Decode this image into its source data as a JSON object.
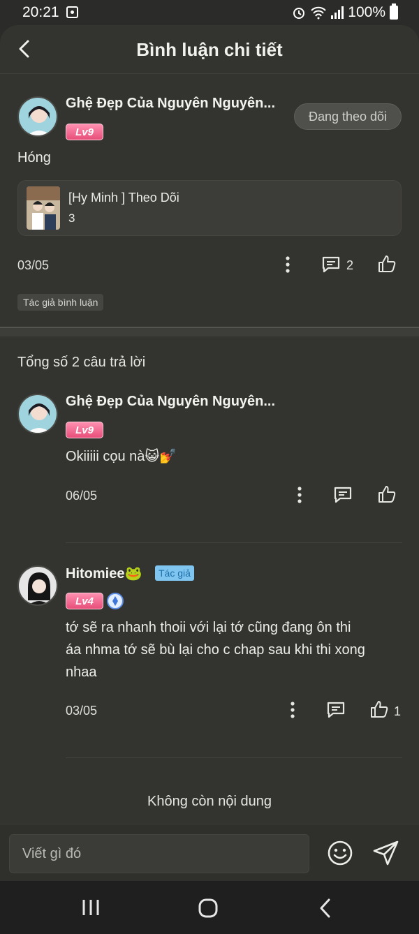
{
  "status": {
    "time": "20:21",
    "battery": "100%"
  },
  "header": {
    "title": "Bình luận chi tiết"
  },
  "main_comment": {
    "username": "Ghệ Đẹp Của Nguyên Nguyên...",
    "level": "Lv9",
    "follow_label": "Đang theo dõi",
    "text": "Hóng",
    "link_card": {
      "title": "[Hy Minh ] Theo Dõi",
      "subtitle": "3"
    },
    "date": "03/05",
    "reply_count": "2",
    "author_tag": "Tác giả bình luận"
  },
  "replies_header": "Tổng số 2 câu trả lời",
  "replies": [
    {
      "username": "Ghệ Đẹp Của Nguyên Nguyên...",
      "level": "Lv9",
      "text": "Okiiiii cọu nà😺💅",
      "date": "06/05"
    },
    {
      "username": "Hitomiee🐸",
      "author_badge": "Tác giả",
      "level": "Lv4",
      "text_lines": [
        "tớ sẽ ra nhanh thoii với lại tớ cũng đang ôn thi",
        "áa nhma tớ sẽ bù lại cho c chap sau khi thi xong",
        "nhaa"
      ],
      "date": "03/05",
      "like_count": "1"
    }
  ],
  "end_label": "Không còn nội dung",
  "composer": {
    "placeholder": "Viết gì đó"
  },
  "colors": {
    "background": "#33332f",
    "level_badge": "#e74f7a",
    "author_badge": "#7fc5ef"
  }
}
